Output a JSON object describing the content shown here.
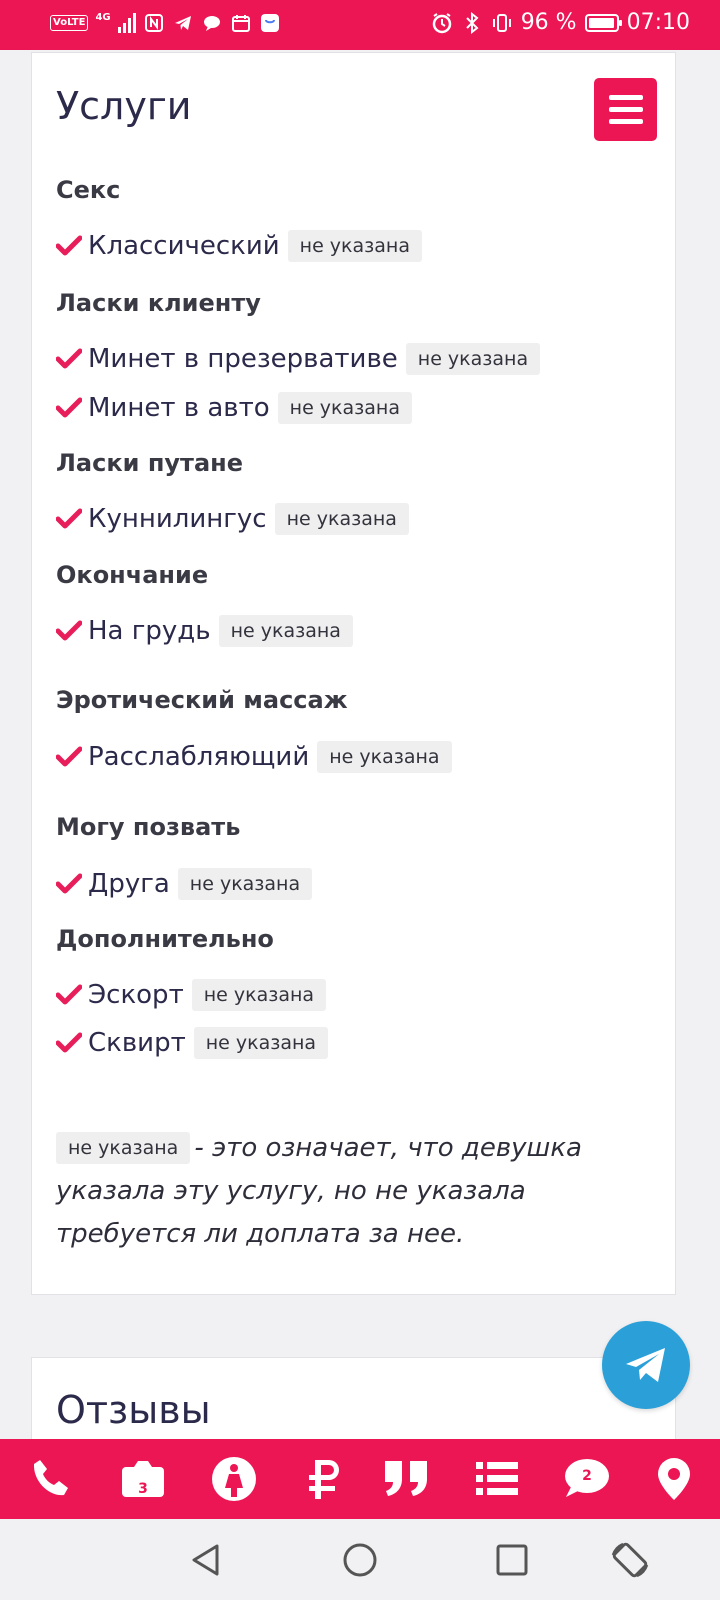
{
  "status_bar": {
    "network_badge": "VoLTE",
    "network_type": "4G",
    "battery_text": "96 %",
    "time": "07:10",
    "battery_level": 0.96
  },
  "services": {
    "title": "Услуги",
    "badge_text": "не указана",
    "categories": [
      {
        "name": "Секс",
        "items": [
          "Классический"
        ]
      },
      {
        "name": "Ласки клиенту",
        "items": [
          "Минет в презервативе",
          "Минет в авто"
        ]
      },
      {
        "name": "Ласки путане",
        "items": [
          "Куннилингус"
        ]
      },
      {
        "name": "Окончание",
        "items": [
          "На грудь"
        ]
      },
      {
        "name": "Эротический массаж",
        "items": [
          "Расслабляющий"
        ]
      },
      {
        "name": "Могу позвать",
        "items": [
          "Друга"
        ]
      },
      {
        "name": "Дополнительно",
        "items": [
          "Эскорт",
          "Сквирт"
        ]
      }
    ],
    "note_badge": "не указана",
    "note_text": "- это означает, что девушка указала эту услугу, но не указала требуется ли доплата за нее."
  },
  "reviews": {
    "title": "Отзывы"
  },
  "bottom_nav": {
    "photos_count": "3",
    "chat_count": "2",
    "icons": [
      "phone-icon",
      "camera-icon",
      "person-icon",
      "ruble-icon",
      "quote-icon",
      "list-icon",
      "chat-icon",
      "location-icon"
    ]
  },
  "colors": {
    "accent": "#ec1654",
    "telegram": "#2ba0d8"
  }
}
